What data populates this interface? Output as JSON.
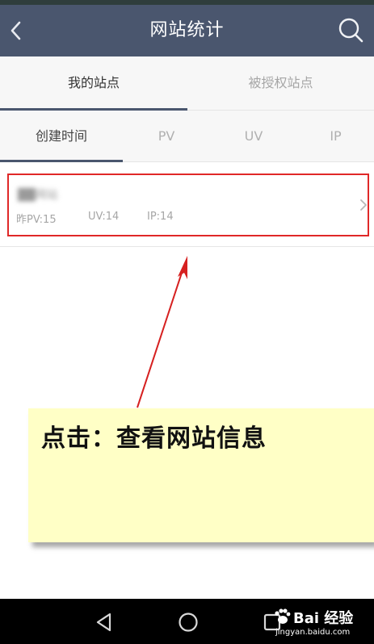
{
  "header": {
    "title": "网站统计",
    "back_icon": "chevron-left-icon",
    "search_icon": "search-icon"
  },
  "main_tabs": [
    {
      "label": "我的站点",
      "active": true
    },
    {
      "label": "被授权站点",
      "active": false
    }
  ],
  "sort_tabs": [
    {
      "label": "创建时间",
      "active": true
    },
    {
      "label": "PV",
      "active": false
    },
    {
      "label": "UV",
      "active": false
    },
    {
      "label": "IP",
      "active": false
    }
  ],
  "sites": [
    {
      "name": "██网站",
      "pv": "昨PV:15",
      "uv": "UV:14",
      "ip": "IP:14"
    }
  ],
  "annotation": {
    "note": "点击：查看网站信息",
    "box_color": "#e02828",
    "note_color": "#ffffc6"
  },
  "nav": {
    "back_icon": "triangle-back-icon",
    "home_icon": "circle-home-icon",
    "recent_icon": "square-recent-icon"
  },
  "watermark": {
    "brand": "Bai 经验",
    "url": "jingyan.baidu.com"
  },
  "colors": {
    "header_bg": "#4a566e",
    "tab_bg": "#f7f7f7",
    "indicator": "#4a566e"
  }
}
